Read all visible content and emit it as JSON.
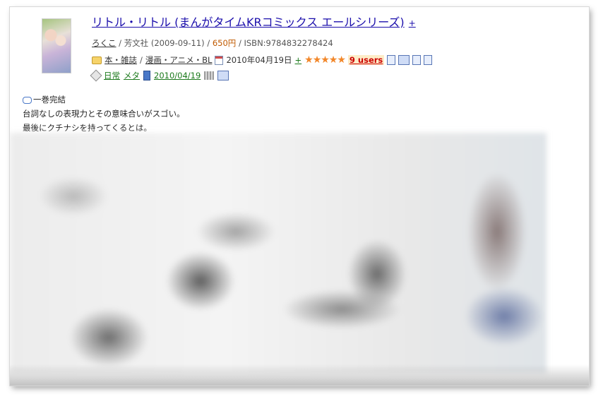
{
  "book": {
    "title": "リトル・リトル (まんがタイムKRコミックス エールシリーズ)",
    "title_plus": "+",
    "author": "ろくこ",
    "publisher": "芳文社",
    "date": "(2009-09-11)",
    "price": "650円",
    "isbn": "ISBN:9784832278424"
  },
  "category": {
    "cat1": "本・雑誌",
    "cat2": "漫画・アニメ・BL",
    "entry_date": "2010年04月19日",
    "entry_plus": "+",
    "stars": "★★★★★",
    "users": "9 users"
  },
  "tags": {
    "tag1": "日常",
    "tag2": "メタ",
    "date": "2010/04/19"
  },
  "comment": {
    "line1": "一巻完結",
    "line2": "台詞なしの表現力とその意味合いがスゴい。",
    "line3": "最後にクチナシを持ってくるとは。"
  },
  "icons": [
    "folder-icon",
    "calendar-icon",
    "doc-icon",
    "tag-icon",
    "book-icon",
    "bubble-icon"
  ],
  "colors": {
    "link": "#1a0dab",
    "price": "#c05a00",
    "users": "#cc0000",
    "tag": "#1c7a1c",
    "star": "#f2872a"
  }
}
